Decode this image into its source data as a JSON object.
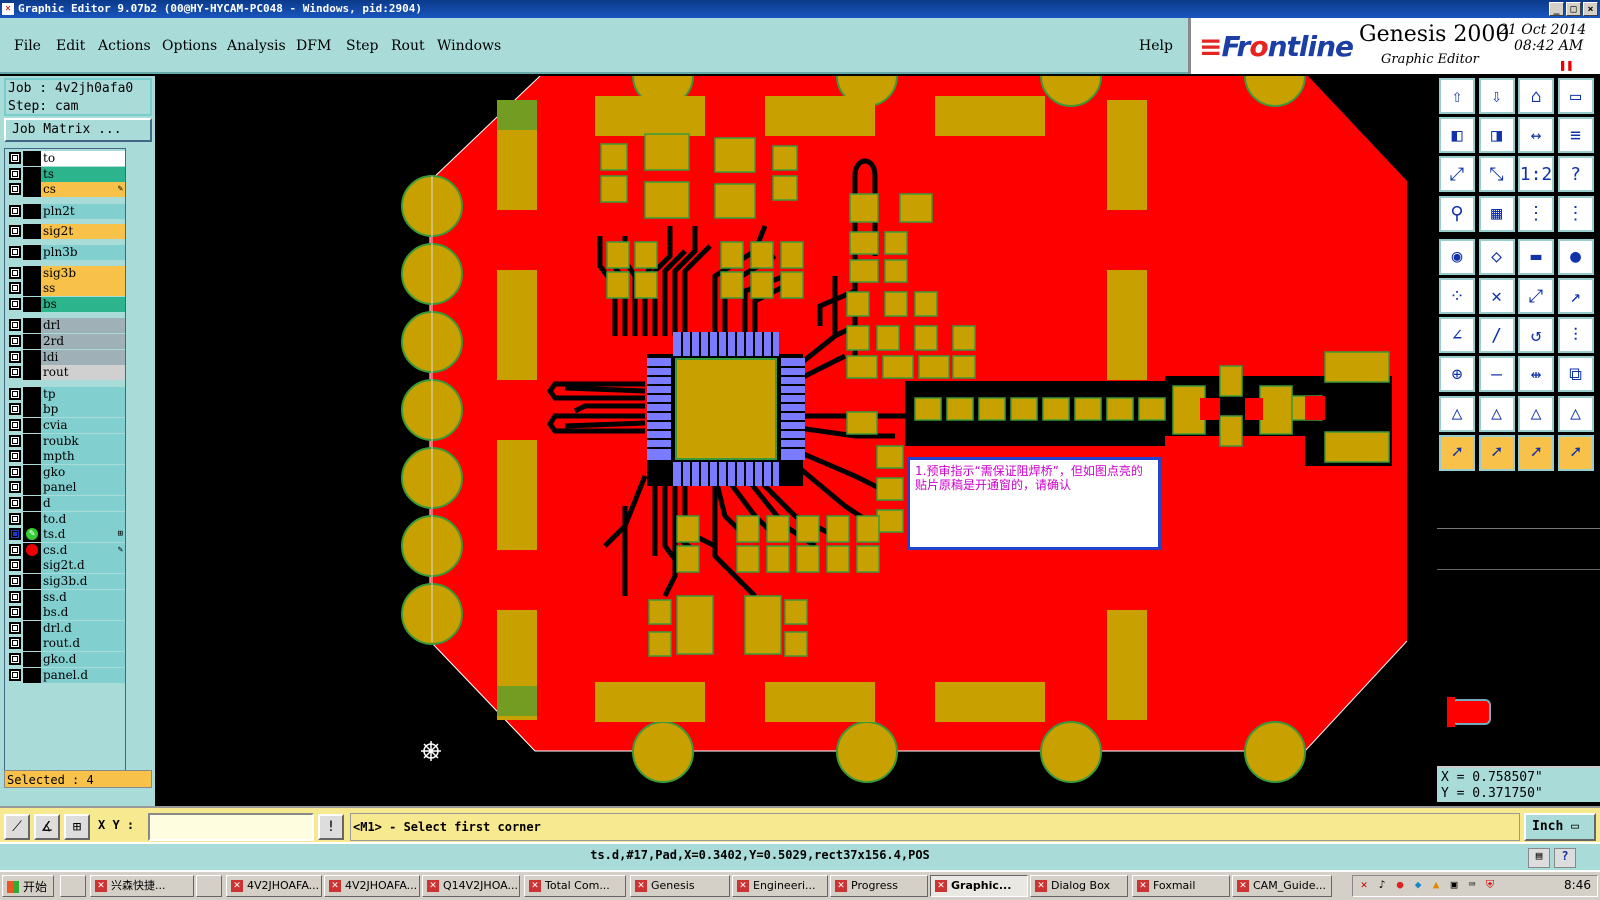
{
  "window": {
    "title": "Graphic Editor 9.07b2 (00@HY-HYCAM-PC048 - Windows, pid:2904)",
    "controls": [
      "_",
      "□",
      "×"
    ]
  },
  "menu": {
    "items": [
      "File",
      "Edit",
      "Actions",
      "Options",
      "Analysis",
      "DFM",
      "Step",
      "Rout",
      "Windows"
    ],
    "help": "Help"
  },
  "brand": {
    "logo_prefix": "Fr",
    "logo_rest": "ntline",
    "product": "Genesis 2000",
    "subtitle": "Graphic Editor",
    "date": "21 Oct 2014",
    "time": "08:42 AM"
  },
  "job": {
    "job_line": "Job : 4v2jh0afa0",
    "step_line": "Step: cam",
    "matrix_button": "Job Matrix ..."
  },
  "layers": [
    {
      "name": "to",
      "color": "#ffffff"
    },
    {
      "name": "ts",
      "color": "#2cb58c"
    },
    {
      "name": "cs",
      "color": "#f7c14a",
      "flag": "✎"
    },
    {
      "name": "pln2t",
      "color": "#82cfd0"
    },
    {
      "name": "sig2t",
      "color": "#f7c14a"
    },
    {
      "name": "pln3b",
      "color": "#82cfd0"
    },
    {
      "name": "sig3b",
      "color": "#f7c14a"
    },
    {
      "name": "ss",
      "color": "#f7c14a"
    },
    {
      "name": "bs",
      "color": "#2cb58c"
    },
    {
      "name": "drl",
      "color": "#9fb0b6"
    },
    {
      "name": "2rd",
      "color": "#9fb0b6"
    },
    {
      "name": "ldi",
      "color": "#9fb0b6"
    },
    {
      "name": "rout",
      "color": "#d0d0d0"
    },
    {
      "name": "tp",
      "color": "#82cfd0"
    },
    {
      "name": "bp",
      "color": "#82cfd0"
    },
    {
      "name": "cvia",
      "color": "#82cfd0"
    },
    {
      "name": "roubk",
      "color": "#82cfd0"
    },
    {
      "name": "mpth",
      "color": "#82cfd0"
    },
    {
      "name": "gko",
      "color": "#82cfd0"
    },
    {
      "name": "panel",
      "color": "#82cfd0"
    },
    {
      "name": "d",
      "color": "#82cfd0"
    },
    {
      "name": "to.d",
      "color": "#82cfd0"
    },
    {
      "name": "ts.d",
      "color": "#82cfd0",
      "work": true,
      "flag": "⊞"
    },
    {
      "name": "cs.d",
      "color": "#82cfd0",
      "affected": true,
      "flag": "✎"
    },
    {
      "name": "sig2t.d",
      "color": "#82cfd0"
    },
    {
      "name": "sig3b.d",
      "color": "#82cfd0"
    },
    {
      "name": "ss.d",
      "color": "#82cfd0"
    },
    {
      "name": "bs.d",
      "color": "#82cfd0"
    },
    {
      "name": "drl.d",
      "color": "#82cfd0"
    },
    {
      "name": "rout.d",
      "color": "#82cfd0"
    },
    {
      "name": "gko.d",
      "color": "#82cfd0"
    },
    {
      "name": "panel.d",
      "color": "#82cfd0"
    }
  ],
  "selected_status": "Selected : 4",
  "note_text": "1.预审指示“需保证阻焊桥”，但如图点亮的贴片原稿是开通窗的，请确认",
  "coords": {
    "x": "X = 0.758507\"",
    "y": "Y = 0.371750\""
  },
  "command": {
    "xy_label": "X Y :",
    "xy_value": "",
    "message": "<M1> - Select first corner",
    "units": "Inch"
  },
  "status_line": "ts.d,#17,Pad,X=0.3402,Y=0.5029,rect37x156.4,POS",
  "taskbar": {
    "start": "开始",
    "tasks": [
      "兴森快捷...",
      "4V2JHOAFA...",
      "4V2JHOAFA...",
      "Q14V2JHOA...",
      "Total Com...",
      "Genesis",
      "Engineeri...",
      "Progress",
      "Graphic...",
      "Dialog Box",
      "Foxmail",
      "CAM_Guide..."
    ],
    "active_index": 8,
    "clock": "8:46"
  },
  "colors": {
    "board": "#ff0000",
    "pad": "#c8a000",
    "pad_edge": "#3a9a3a",
    "ic_pad": "#7b7bff",
    "panel_bg": "#a9dcd9"
  }
}
